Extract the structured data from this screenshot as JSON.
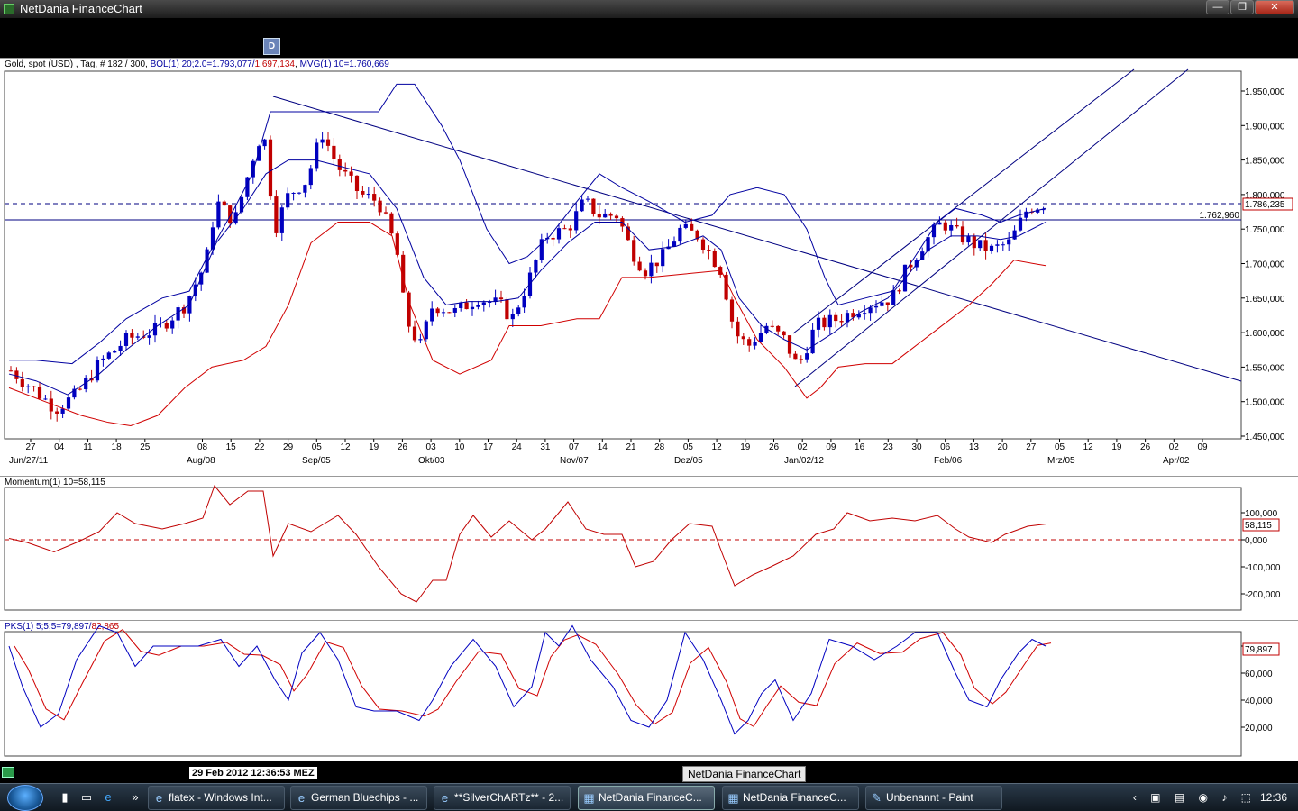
{
  "window": {
    "title": "NetDania FinanceChart",
    "min_glyph": "—",
    "max_glyph": "❐",
    "close_glyph": "✕"
  },
  "toolbar": {
    "d_button_label": "D"
  },
  "main_pane": {
    "legend": {
      "prefix": "Gold, spot (USD) , Tag, # 182 / 300,",
      "bol_label": "BOL(1) 20;2.0=1.793,077/",
      "bol_lower": "1.697,134",
      "sep": ",",
      "mvg_label": "MVG(1) 10=1.760,669"
    },
    "price_box": "1.786,235",
    "hline_label": "1.762,960",
    "y_ticks": [
      "1.950,000",
      "1.900,000",
      "1.850,000",
      "1.800,000",
      "1.750,000",
      "1.700,000",
      "1.650,000",
      "1.600,000",
      "1.550,000",
      "1.500,000",
      "1.450,000"
    ],
    "x_day_ticks": [
      "27",
      "04",
      "11",
      "18",
      "25",
      "08",
      "15",
      "22",
      "29",
      "05",
      "12",
      "19",
      "26",
      "03",
      "10",
      "17",
      "24",
      "31",
      "07",
      "14",
      "21",
      "28",
      "05",
      "12",
      "19",
      "26",
      "02",
      "09",
      "16",
      "23",
      "30",
      "06",
      "13",
      "20",
      "27",
      "05",
      "12",
      "19",
      "26",
      "02",
      "09"
    ],
    "x_month_ticks": [
      "Jun/27/11",
      "Aug/08",
      "Sep/05",
      "Okt/03",
      "Nov/07",
      "Dez/05",
      "Jan/02/12",
      "Feb/06",
      "Mrz/05",
      "Apr/02"
    ]
  },
  "momentum_pane": {
    "legend": "Momentum(1) 10=58,115",
    "value_box": "58,115",
    "y_ticks": [
      "100,000",
      "0,000",
      "-100,000",
      "-200,000"
    ]
  },
  "pks_pane": {
    "legend_blue": "PKS(1) 5;5;5=79,897/",
    "legend_red": "82,865",
    "value_box": "79,897",
    "y_ticks": [
      "80,000",
      "60,000",
      "40,000",
      "20,000"
    ]
  },
  "chart_data": [
    {
      "type": "candlestick",
      "title": "Gold, spot (USD)",
      "ylim": [
        1450,
        1975
      ],
      "x_range": [
        "2011-06-27",
        "2012-04-09"
      ],
      "series": [
        {
          "name": "BOL(1) 20;2.0 upper"
        },
        {
          "name": "BOL(1) 20;2.0 lower"
        },
        {
          "name": "MVG(1) 10"
        }
      ],
      "horizontal_line": 1762.96,
      "last_price": 1786.235,
      "colors": {
        "up": "#0000c0",
        "down": "#c00000",
        "upper_band": "#0000a0",
        "lower_band": "#d00000"
      }
    },
    {
      "type": "line",
      "title": "Momentum(1) 10",
      "ylim": [
        -240,
        180
      ],
      "last_value": 58.115,
      "colors": {
        "line": "#c00000"
      }
    },
    {
      "type": "line",
      "title": "PKS(1) 5;5;5",
      "ylim": [
        0,
        100
      ],
      "series": [
        {
          "name": "%K",
          "last": 79.897
        },
        {
          "name": "%D",
          "last": 82.865
        }
      ],
      "colors": {
        "k": "#0000c0",
        "d": "#d00000"
      }
    }
  ],
  "status": {
    "timestamp": "29 Feb 2012 12:36:53 MEZ"
  },
  "tooltip": "NetDania FinanceChart",
  "taskbar": {
    "tasks": [
      {
        "label": "flatex - Windows Int...",
        "icon": "ie-icon"
      },
      {
        "label": "German Bluechips - ...",
        "icon": "ie-icon"
      },
      {
        "label": "**SilverChARTz** - 2...",
        "icon": "ie-icon"
      },
      {
        "label": "NetDania FinanceC...",
        "icon": "netdania-icon"
      },
      {
        "label": "NetDania FinanceC...",
        "icon": "netdania-icon"
      },
      {
        "label": "Unbenannt - Paint",
        "icon": "paint-icon"
      }
    ],
    "clock": "12:36",
    "tray_glyphs": "‹ ▣ ▤ ◉ ♪ ⬚",
    "ql_glyphs": [
      "▮",
      "▭",
      "e",
      "»"
    ]
  }
}
